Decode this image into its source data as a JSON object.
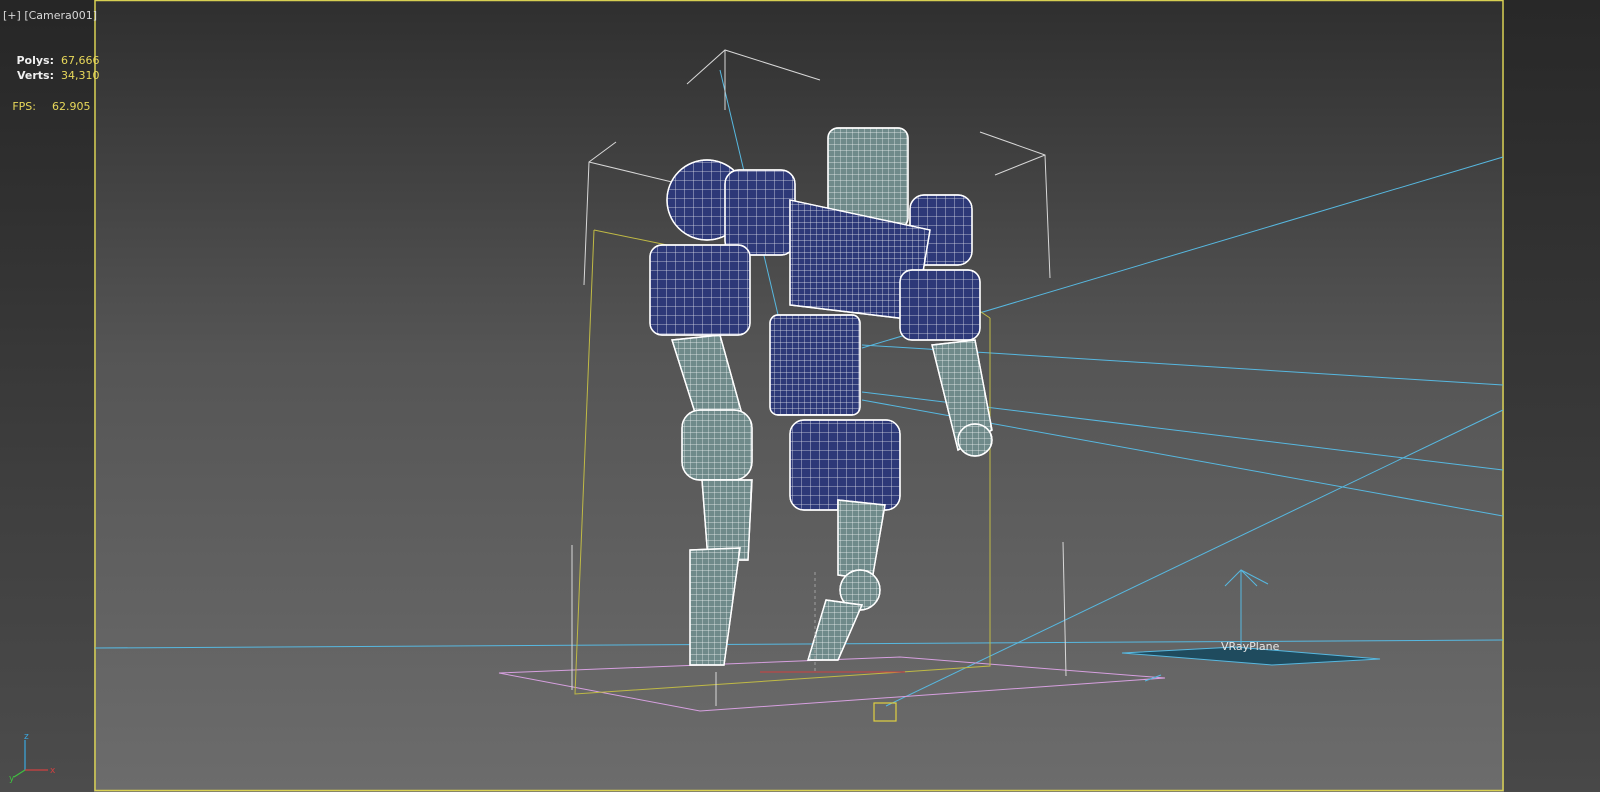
{
  "viewport": {
    "menu_label": "[+]",
    "camera_label": "[Camera001]"
  },
  "stats": {
    "polys_label": "Polys:",
    "polys_value": "67,666",
    "verts_label": "Verts:",
    "verts_value": "34,310",
    "fps_label": "FPS:",
    "fps_value": "62.905"
  },
  "scene": {
    "plane_label": "VRayPlane",
    "gizmo_axes": {
      "x": "x",
      "y": "y",
      "z": "z"
    }
  },
  "colors": {
    "viewport_border": "#d7cf52",
    "stat_value": "#e8d85a",
    "light_lines": "#57b8e0",
    "selection_box": "#d8d8d8",
    "bounding_box": "#c0ba45",
    "ground_plane": "#d7a0e0",
    "mesh_fill": "#2d3978",
    "mesh_fill_light": "#6f8a8a"
  }
}
